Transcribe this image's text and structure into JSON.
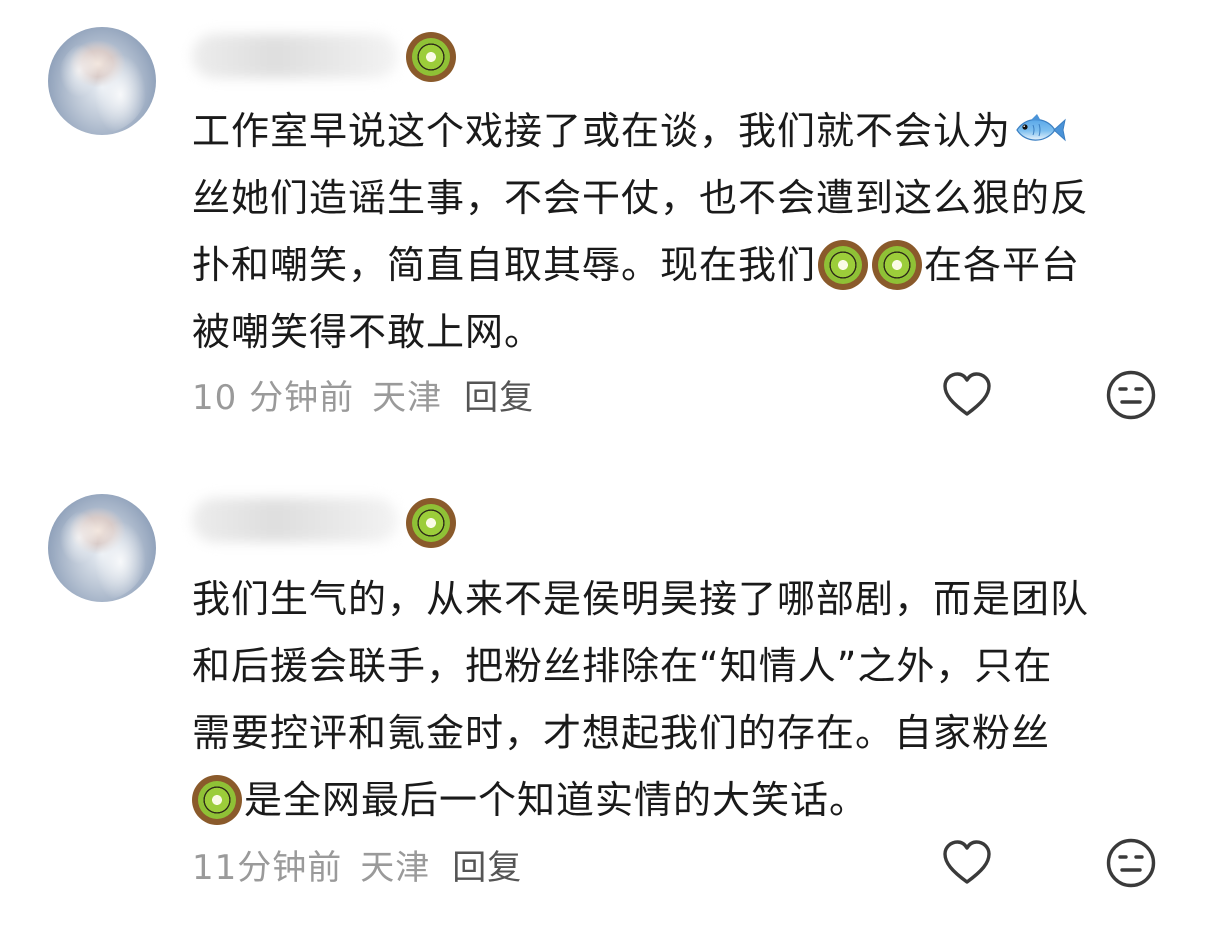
{
  "comments": [
    {
      "lines": [
        {
          "pre": "工作室早说这个戏接了或在谈，我们就不会认为",
          "icon": "fish-icon",
          "post": ""
        },
        {
          "pre": "丝她们造谣生事，不会干仗，也不会遭到这么狠的反",
          "icon": "",
          "post": ""
        },
        {
          "pre": "扑和嘲笑，简直自取其辱。现在我们",
          "icon": "kiwi-kiwi",
          "post": "在各平台"
        },
        {
          "pre": "被嘲笑得不敢上网。",
          "icon": "",
          "post": ""
        }
      ],
      "time": "10 分钟前",
      "location": "天津",
      "reply_label": "回复"
    },
    {
      "lines": [
        {
          "pre": "我们生气的，从来不是侯明昊接了哪部剧，而是团队",
          "icon": "",
          "post": ""
        },
        {
          "pre": "和后援会联手，把粉丝排除在“知情人”之外，只在",
          "icon": "",
          "post": ""
        },
        {
          "pre": "需要控评和氪金时，才想起我们的存在。自家粉丝",
          "icon": "",
          "post": ""
        },
        {
          "pre": "",
          "icon": "kiwi",
          "post": "是全网最后一个知道实情的大笑话。"
        }
      ],
      "time": "11分钟前",
      "location": "天津",
      "reply_label": "回复"
    }
  ],
  "icons": {
    "badge": "kiwi-icon",
    "like": "heart-outline-icon",
    "dislike": "meh-face-icon"
  }
}
